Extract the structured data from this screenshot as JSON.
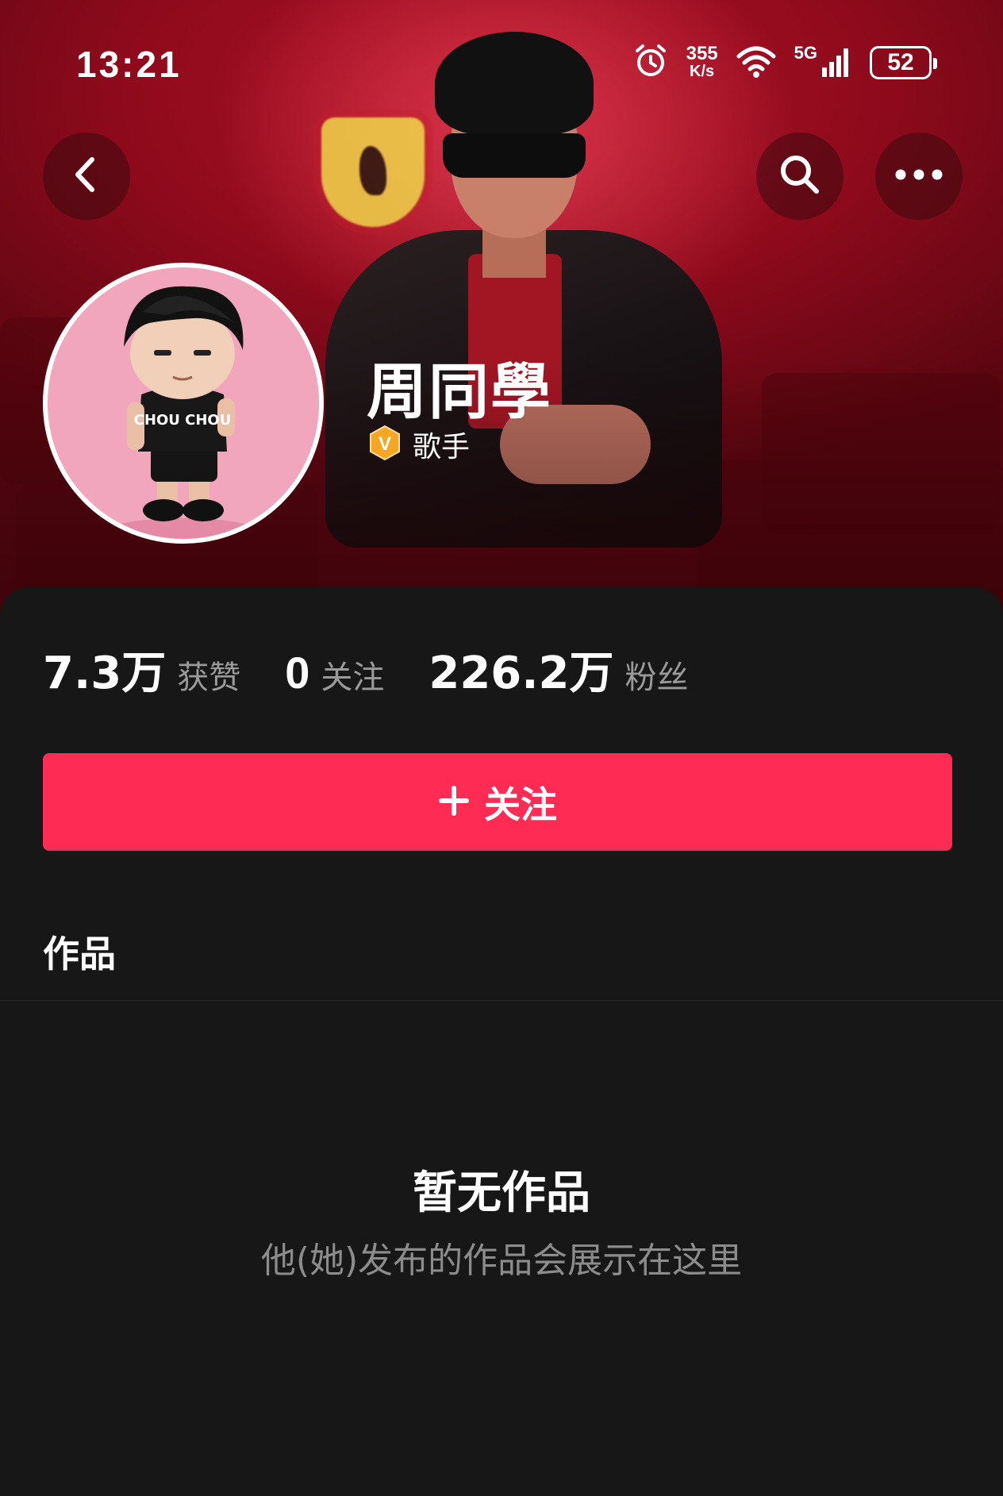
{
  "status_bar": {
    "time": "13:21",
    "net_speed_value": "355",
    "net_speed_unit": "K/s",
    "network_type": "5G",
    "battery_percent": "52"
  },
  "nav": {
    "back_icon": "chevron-left-icon",
    "search_icon": "search-icon",
    "more_icon": "more-horizontal-icon"
  },
  "profile": {
    "display_name": "周同學",
    "verified_role": "歌手",
    "verified_badge_letter": "V",
    "avatar_shirt_text": "CHOU CHOU"
  },
  "stats": [
    {
      "value": "7.3万",
      "label": "获赞"
    },
    {
      "value": "0",
      "label": "关注"
    },
    {
      "value": "226.2万",
      "label": "粉丝"
    }
  ],
  "follow_button": {
    "icon": "plus-icon",
    "label": "关注"
  },
  "works": {
    "title": "作品",
    "empty_title": "暂无作品",
    "empty_subtitle": "他(她)发布的作品会展示在这里"
  },
  "colors": {
    "accent": "#fe2c55",
    "background": "#171717",
    "banner": "#b4132a",
    "badge": "#f5a623"
  }
}
